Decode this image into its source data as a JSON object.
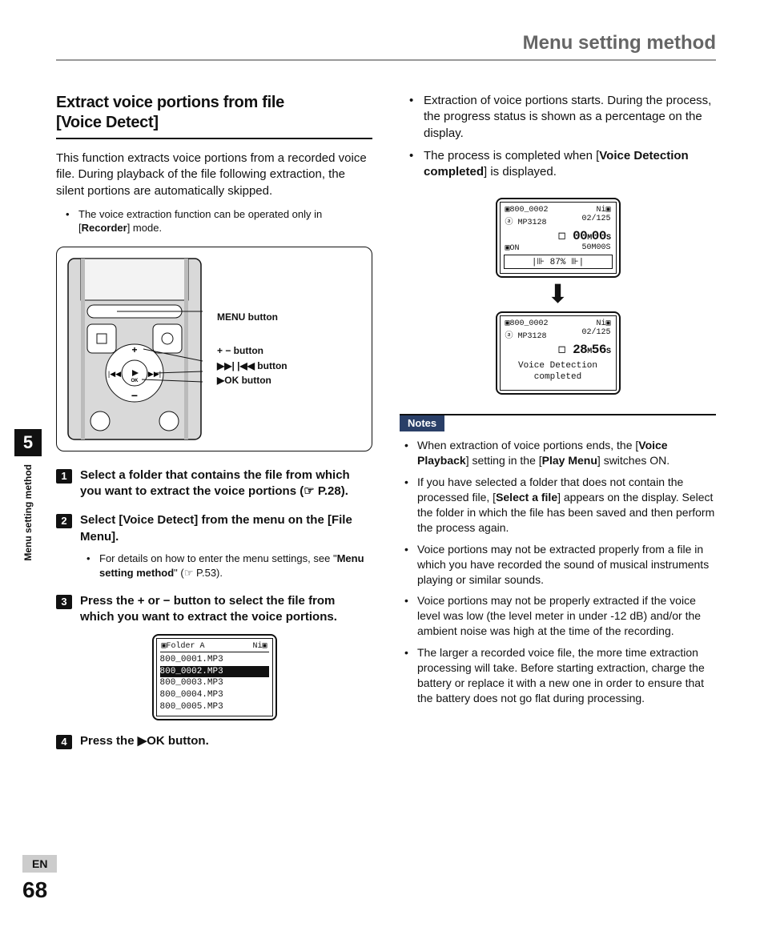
{
  "header": {
    "title": "Menu setting method"
  },
  "sidebar": {
    "chapter": "5",
    "label": "Menu setting method"
  },
  "footer": {
    "lang": "EN",
    "page": "68"
  },
  "left": {
    "h2a": "Extract voice portions from file",
    "h2b": "[Voice Detect]",
    "intro": "This function extracts voice portions from a recorded voice file. During playback of the file following extraction, the silent portions are automatically skipped.",
    "note1a": "The voice extraction function can be operated only in [",
    "note1b": "Recorder",
    "note1c": "] mode.",
    "device": {
      "menu": "MENU button",
      "pm": "+ − button",
      "ffrw": "▶▶| |◀◀ button",
      "ok_prefix": "▶",
      "ok": "OK button"
    },
    "steps": {
      "s1": "Select a folder that contains the file from which you want to extract the voice portions (☞ P.28).",
      "s2a": "Select [",
      "s2b": "Voice Detect",
      "s2c": "] from the menu on the [",
      "s2d": "File Menu",
      "s2e": "].",
      "s2_sub_a": "For details on how to enter the menu settings, see \"",
      "s2_sub_b": "Menu setting method",
      "s2_sub_c": "\" (☞ P.53).",
      "s3": "Press the + or − button to select the file from which you want to extract the voice portions.",
      "s4a": "Press the ",
      "s4b": "▶OK",
      "s4c": " button."
    },
    "lcd1": {
      "title_l": "▣Folder A",
      "title_r": "Ni▣",
      "items": [
        "800_0001.MP3",
        "800_0002.MP3",
        "800_0003.MP3",
        "800_0004.MP3",
        "800_0005.MP3"
      ]
    }
  },
  "right": {
    "b1": "Extraction of voice portions starts. During the process, the progress status is shown as a percentage on the display.",
    "b2a": "The process is completed when [",
    "b2b": "Voice Detection completed",
    "b2c": "] is displayed.",
    "lcd_top": {
      "l1_l": "▣800_0002",
      "l1_r": "Ni▣",
      "l2_l": "ⓐ MP3128",
      "l2_r": "02/125",
      "big_prefix": "◻  ",
      "big": "00",
      "m": "M",
      "big2": "00",
      "s": "S",
      "l4_l": "▣ON",
      "l4_r": "50M00S",
      "pct": "|⊪ 87% ⊪|"
    },
    "lcd_bot": {
      "l1_l": "▣800_0002",
      "l1_r": "Ni▣",
      "l2_l": "ⓐ MP3128",
      "l2_r": "02/125",
      "big_prefix": "◻  ",
      "big": "28",
      "m": "M",
      "big2": "56",
      "s": "S",
      "msg1": "Voice Detection",
      "msg2": "completed"
    },
    "notes_label": "Notes",
    "notes": {
      "n1a": "When extraction of voice portions ends, the [",
      "n1b": "Voice Playback",
      "n1c": "] setting in the [",
      "n1d": "Play Menu",
      "n1e": "] switches ON.",
      "n2a": "If you have selected a folder that does not contain the processed file, [",
      "n2b": "Select a file",
      "n2c": "] appears on the display. Select the folder in which the file has been saved and then perform the process again.",
      "n3": "Voice portions may not be extracted properly from a file in which you have recorded the sound of musical instruments playing or similar sounds.",
      "n4": "Voice portions may not be properly extracted if the voice level was low (the level meter in under -12 dB) and/or the ambient noise was high at the time of the recording.",
      "n5": "The larger a recorded voice file, the more time extraction processing will take. Before starting extraction, charge the battery or replace it with a new one in order to ensure that the battery does not go flat during processing."
    }
  }
}
